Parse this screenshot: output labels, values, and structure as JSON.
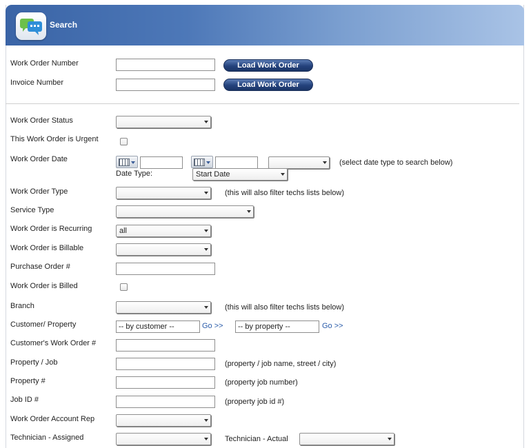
{
  "header": {
    "title": "Search"
  },
  "lookup": {
    "work_order_number_label": "Work Order Number",
    "invoice_number_label": "Invoice Number",
    "load_button_label": "Load Work Order"
  },
  "form": {
    "status_label": "Work Order Status",
    "urgent_label": "This Work Order is Urgent",
    "date_label": "Work Order Date",
    "date_type_label": "Date Type:",
    "date_type_value": "Start Date",
    "date_note": "(select date type to search below)",
    "type_label": "Work Order Type",
    "type_note": "(this will also filter techs lists below)",
    "service_type_label": "Service Type",
    "recurring_label": "Work Order is Recurring",
    "recurring_value": "all",
    "billable_label": "Work Order is Billable",
    "po_label": "Purchase Order #",
    "billed_label": "Work Order is Billed",
    "branch_label": "Branch",
    "branch_note": "(this will also filter techs lists below)",
    "customer_property_label": "Customer/ Property",
    "by_customer_value": "-- by customer --",
    "by_property_value": "-- by property --",
    "go_link": "Go >>",
    "customer_wo_label": "Customer's Work Order #",
    "property_job_label": "Property / Job",
    "property_job_note": "(property / job name, street / city)",
    "property_num_label": "Property #",
    "property_num_note": "(property job number)",
    "job_id_label": "Job ID #",
    "job_id_note": "(property job id #)",
    "account_rep_label": "Work Order Account Rep",
    "tech_assigned_label": "Technician - Assigned",
    "tech_actual_label": "Technician - Actual"
  },
  "icons": {
    "app": "chat-bubbles-icon",
    "calendar": "calendar-icon"
  }
}
